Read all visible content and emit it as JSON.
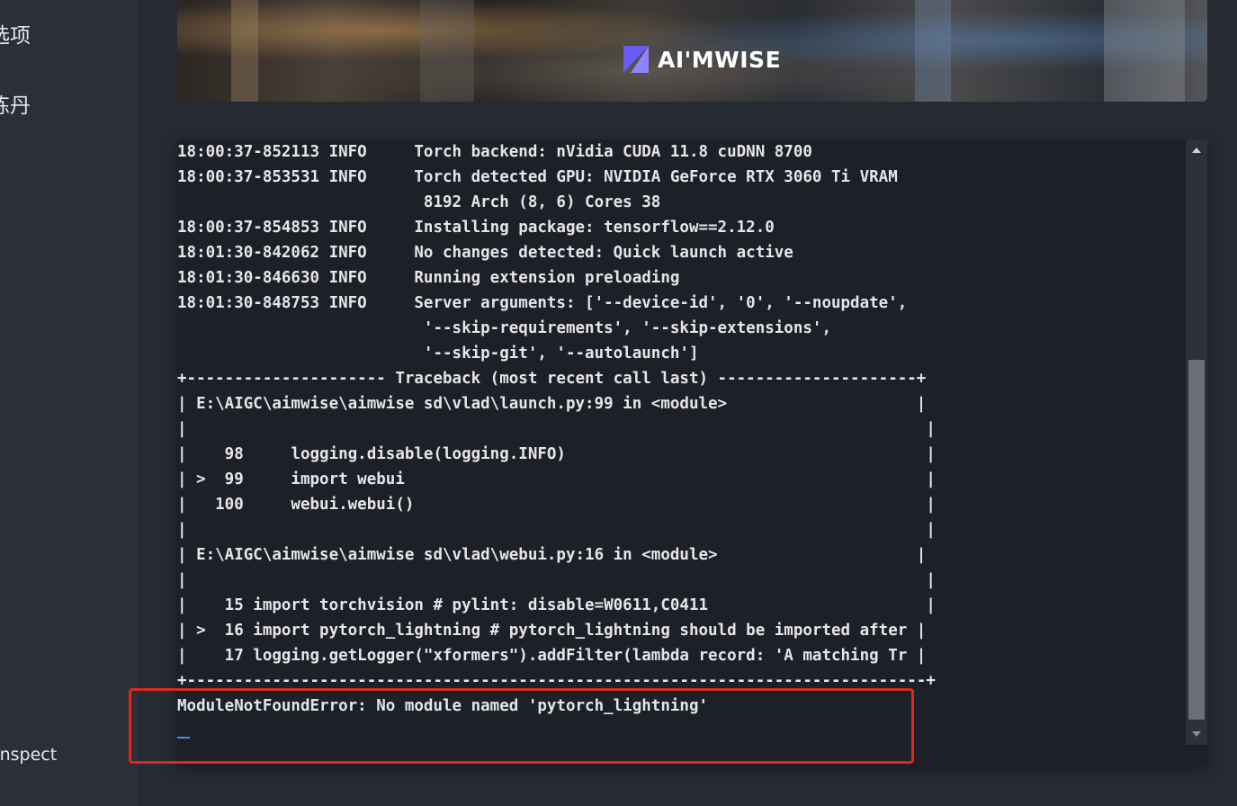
{
  "sidebar": {
    "items": [
      {
        "label": "选项"
      },
      {
        "label": "炼丹"
      }
    ],
    "bottom_item": "Inspect"
  },
  "banner": {
    "logo_text": "AI'MWISE",
    "logo_color": "#6a5cf0"
  },
  "terminal": {
    "lines": [
      "18:00:37-852113 INFO     Torch backend: nVidia CUDA 11.8 cuDNN 8700",
      "18:00:37-853531 INFO     Torch detected GPU: NVIDIA GeForce RTX 3060 Ti VRAM",
      "                          8192 Arch (8, 6) Cores 38",
      "18:00:37-854853 INFO     Installing package: tensorflow==2.12.0",
      "18:01:30-842062 INFO     No changes detected: Quick launch active",
      "18:01:30-846630 INFO     Running extension preloading",
      "18:01:30-848753 INFO     Server arguments: ['--device-id', '0', '--noupdate',",
      "                          '--skip-requirements', '--skip-extensions',",
      "                          '--skip-git', '--autolaunch']",
      "+--------------------- Traceback (most recent call last) ---------------------+",
      "| E:\\AIGC\\aimwise\\aimwise sd\\vlad\\launch.py:99 in <module>                    |",
      "|                                                                              |",
      "|    98     logging.disable(logging.INFO)                                      |",
      "| >  99     import webui                                                       |",
      "|   100     webui.webui()                                                      |",
      "|                                                                              |",
      "| E:\\AIGC\\aimwise\\aimwise sd\\vlad\\webui.py:16 in <module>                     |",
      "|                                                                              |",
      "|    15 import torchvision # pylint: disable=W0611,C0411                       |",
      "| >  16 import pytorch_lightning # pytorch_lightning should be imported after |",
      "|    17 logging.getLogger(\"xformers\").addFilter(lambda record: 'A matching Tr |",
      "+------------------------------------------------------------------------------+",
      "ModuleNotFoundError: No module named 'pytorch_lightning'"
    ],
    "error_highlight_color": "#e0271e"
  }
}
